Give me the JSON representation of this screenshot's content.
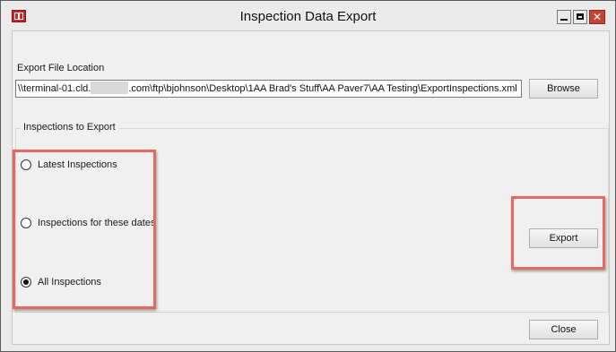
{
  "window": {
    "title": "Inspection Data Export",
    "controls": {
      "minimize_icon": "minimize-icon",
      "maximize_icon": "maximize-icon",
      "close_icon": "close-icon",
      "close_glyph": "✕"
    }
  },
  "export_location": {
    "label": "Export File Location",
    "path_prefix": "\\\\terminal-01.cld.",
    "path_suffix": ".com\\ftp\\bjohnson\\Desktop\\1AA Brad's Stuff\\AA Paver7\\AA Testing\\ExportInspections.xml",
    "browse_label": "Browse"
  },
  "inspections_group": {
    "legend": "Inspections to Export",
    "options": [
      {
        "label": "Latest Inspections",
        "checked": false
      },
      {
        "label": "Inspections for these dates",
        "checked": false
      },
      {
        "label": "All Inspections",
        "checked": true
      }
    ],
    "export_label": "Export"
  },
  "footer": {
    "close_label": "Close"
  },
  "colors": {
    "highlight": "#e4695f",
    "window_bg": "#ebebeb",
    "client_bg": "#f0f0f0",
    "close_button": "#c44536"
  }
}
